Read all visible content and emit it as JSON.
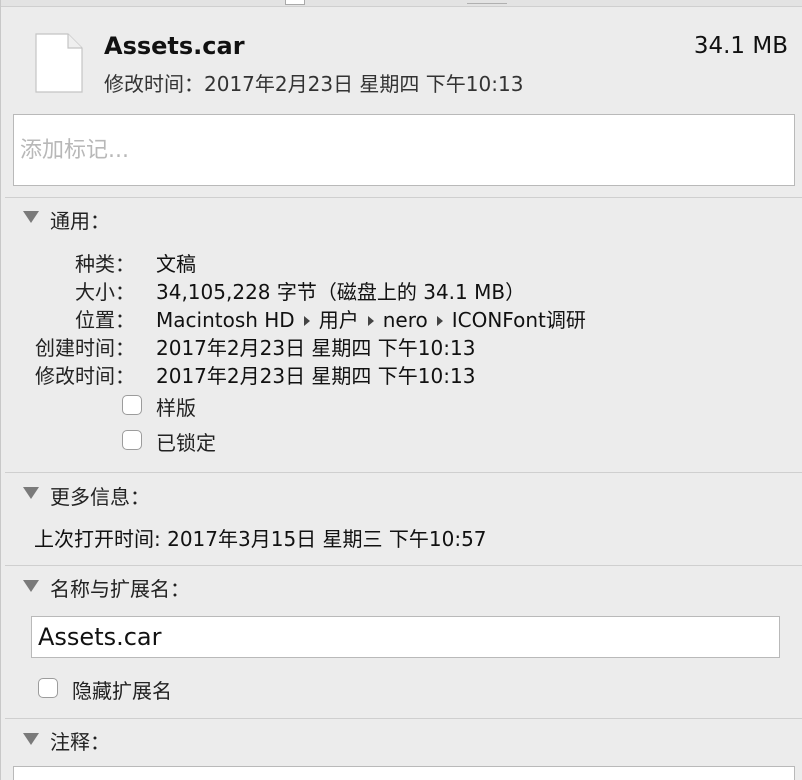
{
  "header": {
    "file_name": "Assets.car",
    "file_size": "34.1 MB",
    "modified": "修改时间：2017年2月23日 星期四 下午10:13"
  },
  "tags": {
    "placeholder": "添加标记..."
  },
  "general": {
    "title": "通用：",
    "rows": [
      {
        "label": "种类：",
        "value": "文稿"
      },
      {
        "label": "大小：",
        "value": "34,105,228 字节（磁盘上的 34.1 MB）"
      },
      {
        "label": "位置：",
        "path": [
          "Macintosh HD",
          "用户",
          "nero",
          "ICONFont调研"
        ]
      },
      {
        "label": "创建时间：",
        "value": "2017年2月23日 星期四 下午10:13"
      },
      {
        "label": "修改时间：",
        "value": "2017年2月23日 星期四 下午10:13"
      }
    ],
    "stationery_label": "样版",
    "stationery_checked": false,
    "locked_label": "已锁定",
    "locked_checked": false
  },
  "more_info": {
    "title": "更多信息：",
    "last_opened": "上次打开时间: 2017年3月15日 星期三 下午10:57"
  },
  "name_extension": {
    "title": "名称与扩展名：",
    "name_value": "Assets.car",
    "hide_extension_label": "隐藏扩展名",
    "hide_extension_checked": false
  },
  "comments": {
    "title": "注释："
  },
  "icons": {
    "file": "document-icon",
    "disclosure": "disclosure-triangle-icon",
    "path_separator": "path-arrow-icon"
  }
}
